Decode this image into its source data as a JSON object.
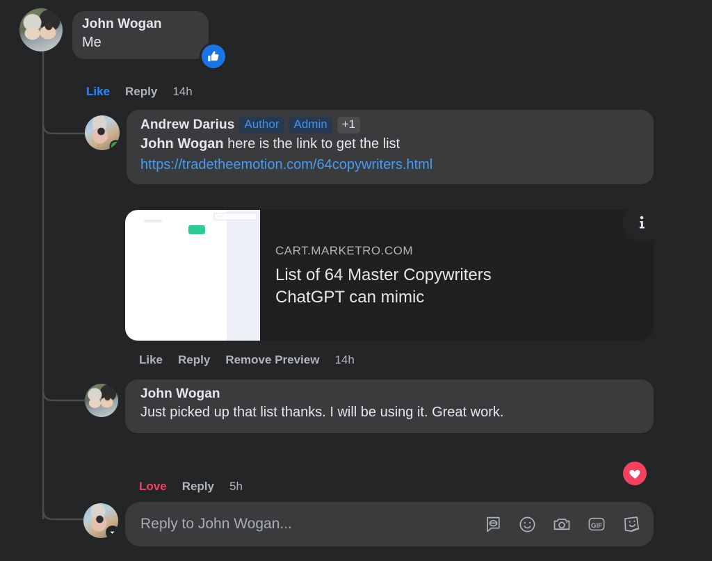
{
  "thread": {
    "comments": [
      {
        "id": "c1",
        "author": "John Wogan",
        "text": "Me",
        "avatar": "john-wogan-avatar",
        "reaction": "thumbs-up-reaction",
        "actions": {
          "like": "Like",
          "reply": "Reply",
          "time": "14h"
        },
        "like_active": true
      },
      {
        "id": "c2",
        "author": "Andrew Darius",
        "badges": [
          {
            "label": "Author",
            "style": "blue"
          },
          {
            "label": "Admin",
            "style": "blue"
          },
          {
            "label": "+1",
            "style": "grey"
          }
        ],
        "mention": "John Wogan",
        "text": " here is the link to get the list",
        "link": "https://tradetheemotion.com/64copywriters.html",
        "avatar": "andrew-darius-avatar",
        "online": true,
        "actions": {
          "like": "Like",
          "reply": "Reply",
          "remove": "Remove Preview",
          "time": "14h"
        },
        "preview": {
          "domain": "CART.MARKETRO.COM",
          "title_line1": "List of 64 Master Copywriters",
          "title_line2": "ChatGPT can mimic",
          "info_icon": "info-icon"
        }
      },
      {
        "id": "c3",
        "author": "John Wogan",
        "text": "Just picked up that list thanks. I will be using it. Great work.",
        "avatar": "john-wogan-avatar",
        "reaction": "heart-reaction",
        "actions": {
          "love": "Love",
          "reply": "Reply",
          "time": "5h"
        },
        "love_active": true
      }
    ]
  },
  "composer": {
    "placeholder": "Reply to John Wogan...",
    "avatar": "andrew-darius-avatar",
    "icons": [
      {
        "name": "avatar-sticker-icon"
      },
      {
        "name": "emoji-icon"
      },
      {
        "name": "camera-icon"
      },
      {
        "name": "gif-icon",
        "label": "GIF"
      },
      {
        "name": "sticker-icon"
      }
    ]
  },
  "colors": {
    "page_bg": "#242526",
    "bubble_bg": "#3a3b3c",
    "link": "#4a9bf5",
    "like_blue": "#1b74e4",
    "love_red": "#f3425f",
    "online_green": "#31a24c",
    "muted_text": "#b0b3b8"
  }
}
